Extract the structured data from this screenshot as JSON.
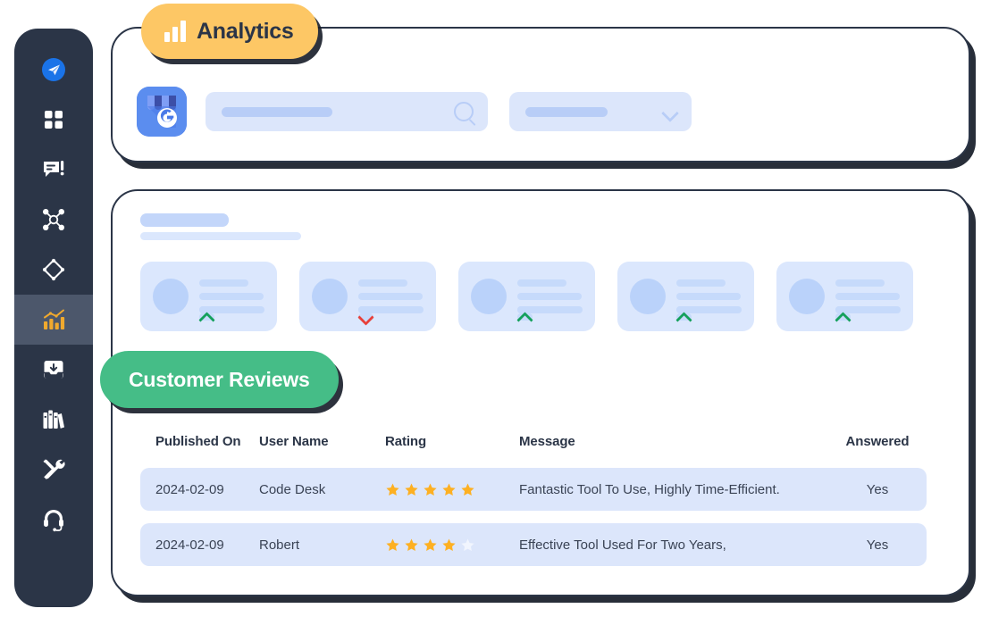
{
  "sidebar": {
    "items": [
      {
        "icon": "paper-plane-icon",
        "name": "send",
        "active": false
      },
      {
        "icon": "dashboard-grid-icon",
        "name": "dashboard",
        "active": false
      },
      {
        "icon": "chat-alert-icon",
        "name": "messages",
        "active": false
      },
      {
        "icon": "network-nodes-icon",
        "name": "network",
        "active": false
      },
      {
        "icon": "diamond-target-icon",
        "name": "targeting",
        "active": false
      },
      {
        "icon": "analytics-chart-icon",
        "name": "analytics",
        "active": true
      },
      {
        "icon": "inbox-download-icon",
        "name": "inbox",
        "active": false
      },
      {
        "icon": "library-books-icon",
        "name": "library",
        "active": false
      },
      {
        "icon": "tools-wrench-icon",
        "name": "tools",
        "active": false
      },
      {
        "icon": "headset-support-icon",
        "name": "support",
        "active": false
      }
    ]
  },
  "analytics_badge": {
    "label": "Analytics",
    "icon": "bar-chart-icon",
    "color": "#fdc765"
  },
  "reviews_badge": {
    "label": "Customer Reviews",
    "color": "#45bd87"
  },
  "toolbar": {
    "logo_icon": "google-my-business-icon",
    "search_placeholder": "",
    "search_value": "",
    "search_icon": "search-icon",
    "select_value": "",
    "select_icon": "chevron-down-icon"
  },
  "reviews_table": {
    "columns": [
      "Published On",
      "User Name",
      "Rating",
      "Message",
      "Answered"
    ],
    "rows": [
      {
        "published_on": "2024-02-09",
        "user_name": "Code Desk",
        "rating": 5,
        "message": "Fantastic Tool To Use, Highly Time-Efficient.",
        "answered": "Yes"
      },
      {
        "published_on": "2024-02-09",
        "user_name": "Robert",
        "rating": 4,
        "message": "Effective Tool Used For Two Years,",
        "answered": "Yes"
      }
    ],
    "max_rating": 5,
    "star_color": "#fdb022",
    "star_empty_color": "#f1f5fe"
  },
  "stat_cards": [
    {
      "trend": "up"
    },
    {
      "trend": "down"
    },
    {
      "trend": "up"
    },
    {
      "trend": "up"
    },
    {
      "trend": "up"
    }
  ],
  "colors": {
    "sidebar_bg": "#2b3547",
    "sidebar_active": "#4c576b",
    "card_border": "#2b3547",
    "skeleton": "#dce6fb",
    "accent_orange": "#fdc765",
    "accent_green": "#45bd87",
    "trend_up": "#14a05c",
    "trend_down": "#e8403a"
  }
}
